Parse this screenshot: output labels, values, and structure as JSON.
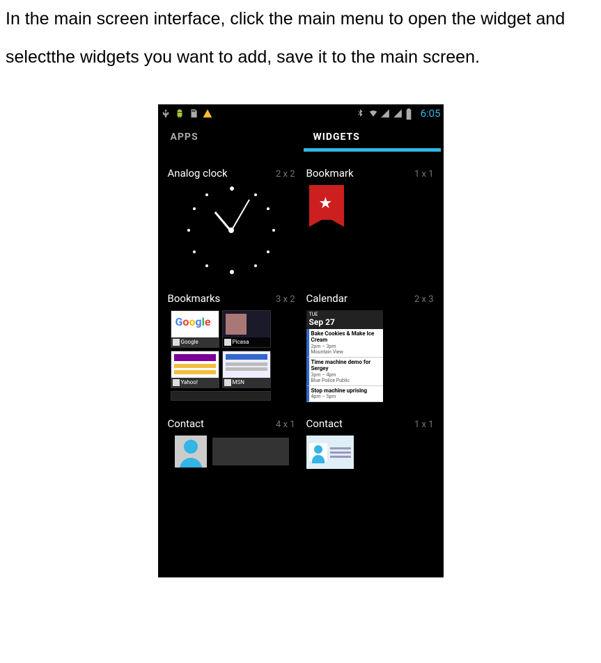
{
  "doc": {
    "text": "In the main screen interface, click the main menu to open the widget and selectthe widgets you want to add, save it to the main screen."
  },
  "statusbar": {
    "left_icons": [
      "usb-icon",
      "android-icon",
      "sdcard-icon",
      "warning-icon"
    ],
    "right_icons": [
      "bluetooth-icon",
      "wifi-icon",
      "signal1-icon",
      "signal2-icon",
      "battery-icon"
    ],
    "time": "6:05"
  },
  "tabs": {
    "apps": "APPS",
    "widgets": "WIDGETS",
    "active": "widgets"
  },
  "widgets": {
    "analog_clock": {
      "title": "Analog clock",
      "size": "2 x 2"
    },
    "bookmark": {
      "title": "Bookmark",
      "size": "1 x 1"
    },
    "bookmarks": {
      "title": "Bookmarks",
      "size": "3 x 2",
      "tiles": [
        "Google",
        "Picasa",
        "Yahoo!",
        "MSN"
      ]
    },
    "calendar": {
      "title": "Calendar",
      "size": "2 x 3",
      "date_label": "TUE",
      "date": "Sep 27",
      "events": [
        {
          "title": "Bake Cookies & Make Ice Cream",
          "when": "2pm – 3pm",
          "where": "Mountain View"
        },
        {
          "title": "Time machine demo for Sergey",
          "when": "3pm – 4pm",
          "where": "Blue Police Public"
        },
        {
          "title": "Stop machine uprising",
          "when": "4pm – 5pm",
          "where": ""
        }
      ]
    },
    "contact_4x1": {
      "title": "Contact",
      "size": "4 x 1"
    },
    "contact_1x1": {
      "title": "Contact",
      "size": "1 x 1"
    }
  }
}
